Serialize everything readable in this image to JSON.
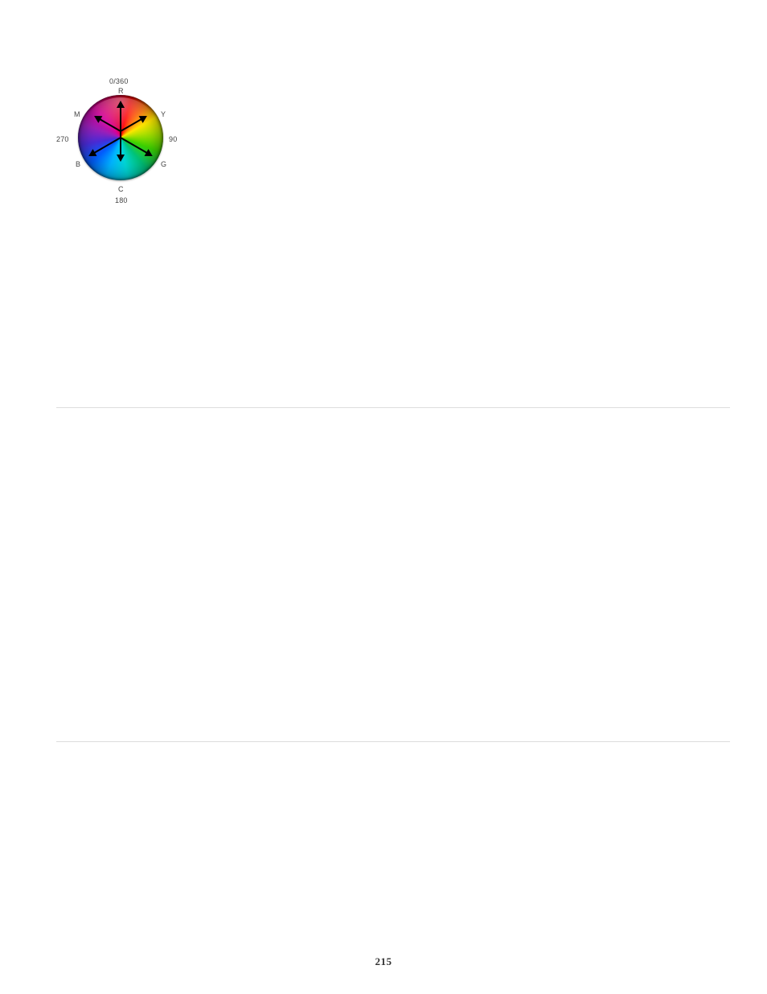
{
  "page_number": "215",
  "color_wheel": {
    "degree_labels": {
      "top": "0/360",
      "right": "90",
      "bottom": "180",
      "left": "270"
    },
    "color_labels": {
      "R": "R",
      "Y": "Y",
      "G": "G",
      "C": "C",
      "B": "B",
      "M": "M"
    }
  }
}
